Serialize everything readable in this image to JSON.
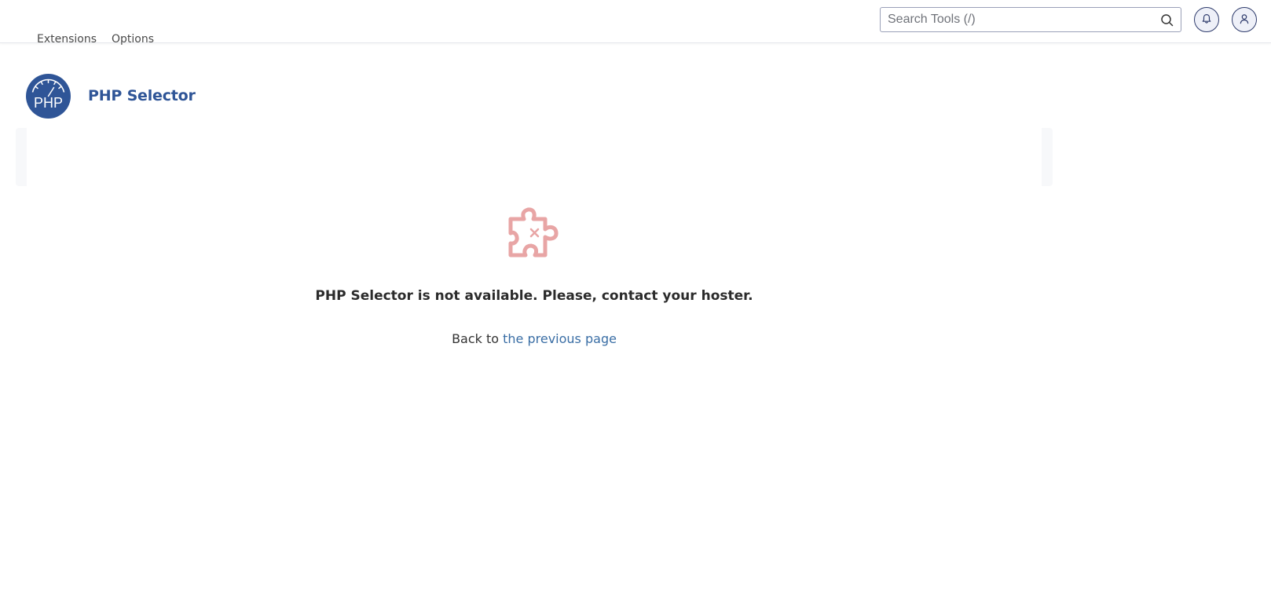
{
  "topbar": {
    "search": {
      "placeholder": "Search Tools (/)",
      "value": "",
      "icon": "search-icon"
    },
    "notifications_icon": "bell-icon",
    "user_icon": "user-icon"
  },
  "app": {
    "logo_text": "PHP",
    "title": "PHP Selector",
    "brand_color": "#2f5597"
  },
  "tabs": [
    {
      "label": "Extensions"
    },
    {
      "label": "Options"
    }
  ],
  "empty_state": {
    "icon": "puzzle-piece-x-icon",
    "icon_color": "#e8a5a5",
    "message": "PHP Selector is not available. Please, contact your hoster.",
    "back_prefix": "Back to ",
    "back_link_label": "the previous page",
    "link_color": "#3a6ea5"
  }
}
